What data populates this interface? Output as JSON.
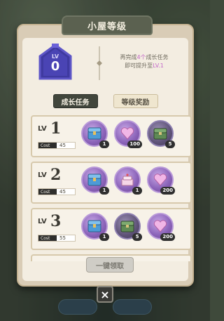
{
  "title": "小屋等级",
  "current_level": {
    "lv_label": "LV",
    "value": "0"
  },
  "hint": {
    "line1_a": "再完成",
    "line1_count": "4个",
    "line1_b": "成长任务",
    "line2_a": "即可提升至",
    "line2_target": "LV.1"
  },
  "tabs": [
    {
      "label": "成长任务",
      "active": true
    },
    {
      "label": "等级奖励",
      "active": false
    }
  ],
  "levels": [
    {
      "lv_label": "LV",
      "level": "1",
      "cost_label": "Cost",
      "cost": "45",
      "rewards": [
        {
          "icon": "treasure-box-icon",
          "qty": "1"
        },
        {
          "icon": "heart-gem-icon",
          "qty": "100"
        },
        {
          "icon": "green-chest-icon",
          "qty": "5"
        }
      ]
    },
    {
      "lv_label": "LV",
      "level": "2",
      "cost_label": "Cost",
      "cost": "45",
      "rewards": [
        {
          "icon": "treasure-box-icon",
          "qty": "1"
        },
        {
          "icon": "cake-icon",
          "qty": "1"
        },
        {
          "icon": "heart-gem-icon",
          "qty": "200"
        }
      ]
    },
    {
      "lv_label": "LV",
      "level": "3",
      "cost_label": "Cost",
      "cost": "55",
      "rewards": [
        {
          "icon": "treasure-box-icon",
          "qty": "1"
        },
        {
          "icon": "green-chest-icon",
          "qty": "5"
        },
        {
          "icon": "heart-gem-icon",
          "qty": "200"
        }
      ]
    }
  ],
  "claim_all_label": "一键领取",
  "close_label": "×",
  "colors": {
    "accent_purple": "#c266c8",
    "panel": "#f3ede1",
    "tab_active": "#41463c"
  }
}
